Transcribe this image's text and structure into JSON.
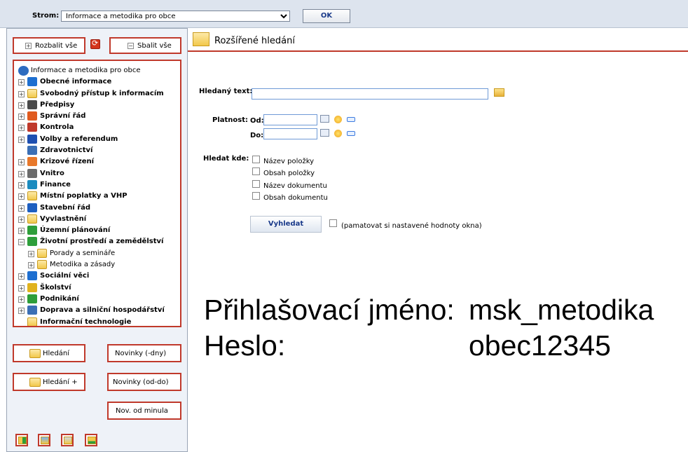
{
  "topbar": {
    "tree_label": "Strom:",
    "tree_select_value": "Informace a metodika pro obce",
    "ok_label": "OK"
  },
  "left": {
    "expand_all": "Rozbalit vše",
    "collapse_all": "Sbalit vše",
    "tree": [
      {
        "label": "Informace a metodika pro obce",
        "level": 0,
        "toggle": "",
        "icon": "root-icon",
        "color": "#2d6cc0",
        "bold": false
      },
      {
        "label": "Obecné informace",
        "level": 1,
        "toggle": "+",
        "icon": "info-icon",
        "color": "#1e6fd0",
        "bold": true
      },
      {
        "label": "Svobodný přístup k informacím",
        "level": 1,
        "toggle": "+",
        "icon": "folder-icon",
        "color": "#f2c84b",
        "bold": true
      },
      {
        "label": "Předpisy",
        "level": 1,
        "toggle": "+",
        "icon": "regulations-icon",
        "color": "#4a4a4a",
        "bold": true
      },
      {
        "label": "Správní řád",
        "level": 1,
        "toggle": "+",
        "icon": "admin-code-icon",
        "color": "#e05a1e",
        "bold": true
      },
      {
        "label": "Kontrola",
        "level": 1,
        "toggle": "+",
        "icon": "magnifier-icon",
        "color": "#c0392b",
        "bold": true
      },
      {
        "label": "Volby a referendum",
        "level": 1,
        "toggle": "+",
        "icon": "flag-icon",
        "color": "#1e4fb0",
        "bold": true
      },
      {
        "label": "Zdravotnictví",
        "level": 1,
        "toggle": "",
        "icon": "health-icon",
        "color": "#3b6fb5",
        "bold": true
      },
      {
        "label": "Krizové řízení",
        "level": 1,
        "toggle": "+",
        "icon": "crisis-icon",
        "color": "#e8782a",
        "bold": true
      },
      {
        "label": "Vnitro",
        "level": 1,
        "toggle": "+",
        "icon": "interior-icon",
        "color": "#6b6b6b",
        "bold": true
      },
      {
        "label": "Finance",
        "level": 1,
        "toggle": "+",
        "icon": "finance-icon",
        "color": "#1b8bbf",
        "bold": true
      },
      {
        "label": "Místní poplatky a VHP",
        "level": 1,
        "toggle": "+",
        "icon": "folder-icon",
        "color": "#f2c84b",
        "bold": true
      },
      {
        "label": "Stavební řád",
        "level": 1,
        "toggle": "+",
        "icon": "building-icon",
        "color": "#1e5fc0",
        "bold": true
      },
      {
        "label": "Vyvlastnění",
        "level": 1,
        "toggle": "+",
        "icon": "folder-icon",
        "color": "#f2c84b",
        "bold": true
      },
      {
        "label": "Územní plánování",
        "level": 1,
        "toggle": "+",
        "icon": "planning-icon",
        "color": "#2e9e3a",
        "bold": true
      },
      {
        "label": "Životní prostředí a zemědělství",
        "level": 1,
        "toggle": "-",
        "icon": "environment-icon",
        "color": "#2e9e3a",
        "bold": true
      },
      {
        "label": "Porady a semináře",
        "level": 2,
        "toggle": "+",
        "icon": "folder-icon",
        "color": "#f2c84b",
        "bold": false
      },
      {
        "label": "Metodika a zásady",
        "level": 2,
        "toggle": "+",
        "icon": "folder-icon",
        "color": "#f2c84b",
        "bold": false
      },
      {
        "label": "Sociální věci",
        "level": 1,
        "toggle": "+",
        "icon": "social-icon",
        "color": "#1e6fd0",
        "bold": true
      },
      {
        "label": "Školství",
        "level": 1,
        "toggle": "+",
        "icon": "school-icon",
        "color": "#e0b21e",
        "bold": true
      },
      {
        "label": "Podnikání",
        "level": 1,
        "toggle": "+",
        "icon": "euro-icon",
        "color": "#2e9e3a",
        "bold": true
      },
      {
        "label": "Doprava a silniční hospodářství",
        "level": 1,
        "toggle": "+",
        "icon": "transport-icon",
        "color": "#3b6fb5",
        "bold": true
      },
      {
        "label": "Informační technologie",
        "level": 1,
        "toggle": "",
        "icon": "folder-icon",
        "color": "#f2c84b",
        "bold": true
      }
    ],
    "btn_search": "Hledání",
    "btn_news_days": "Novinky (-dny)",
    "btn_search_plus": "Hledání +",
    "btn_news_range": "Novinky (od-do)",
    "btn_news_last": "Nov. od minula"
  },
  "right": {
    "title": "Rozšířené hledání",
    "search_text_label": "Hledaný text:",
    "search_text_value": "",
    "validity_label": "Platnost:",
    "from_label": "Od:",
    "to_label": "Do:",
    "search_in_label": "Hledat kde:",
    "options": [
      "Název položky",
      "Obsah položky",
      "Název dokumentu",
      "Obsah dokumentu"
    ],
    "search_button": "Vyhledat",
    "remember_label": "(pamatovat si nastavené hodnoty okna)"
  },
  "overlay": {
    "login_label": "Přihlašovací jméno:",
    "login_value": "msk_metodika",
    "password_label": "Heslo:",
    "password_value": "obec12345"
  }
}
